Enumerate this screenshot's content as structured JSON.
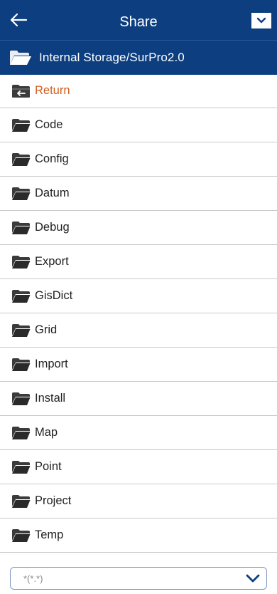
{
  "header": {
    "title": "Share",
    "back_icon": "arrow-left-icon",
    "menu_icon": "dropdown-square-icon",
    "background": "#0d3f80"
  },
  "path": {
    "text": "Internal Storage/SurPro2.0",
    "icon": "folder-open-icon"
  },
  "list": {
    "return_label": "Return",
    "return_icon": "folder-return-icon",
    "items": [
      {
        "label": "Code"
      },
      {
        "label": "Config"
      },
      {
        "label": "Datum"
      },
      {
        "label": "Debug"
      },
      {
        "label": "Export"
      },
      {
        "label": "GisDict"
      },
      {
        "label": "Grid"
      },
      {
        "label": "Import"
      },
      {
        "label": "Install"
      },
      {
        "label": "Map"
      },
      {
        "label": "Point"
      },
      {
        "label": "Project"
      },
      {
        "label": "Temp"
      }
    ]
  },
  "filter": {
    "value": "*(*.*)",
    "icon": "chevron-down-icon"
  }
}
